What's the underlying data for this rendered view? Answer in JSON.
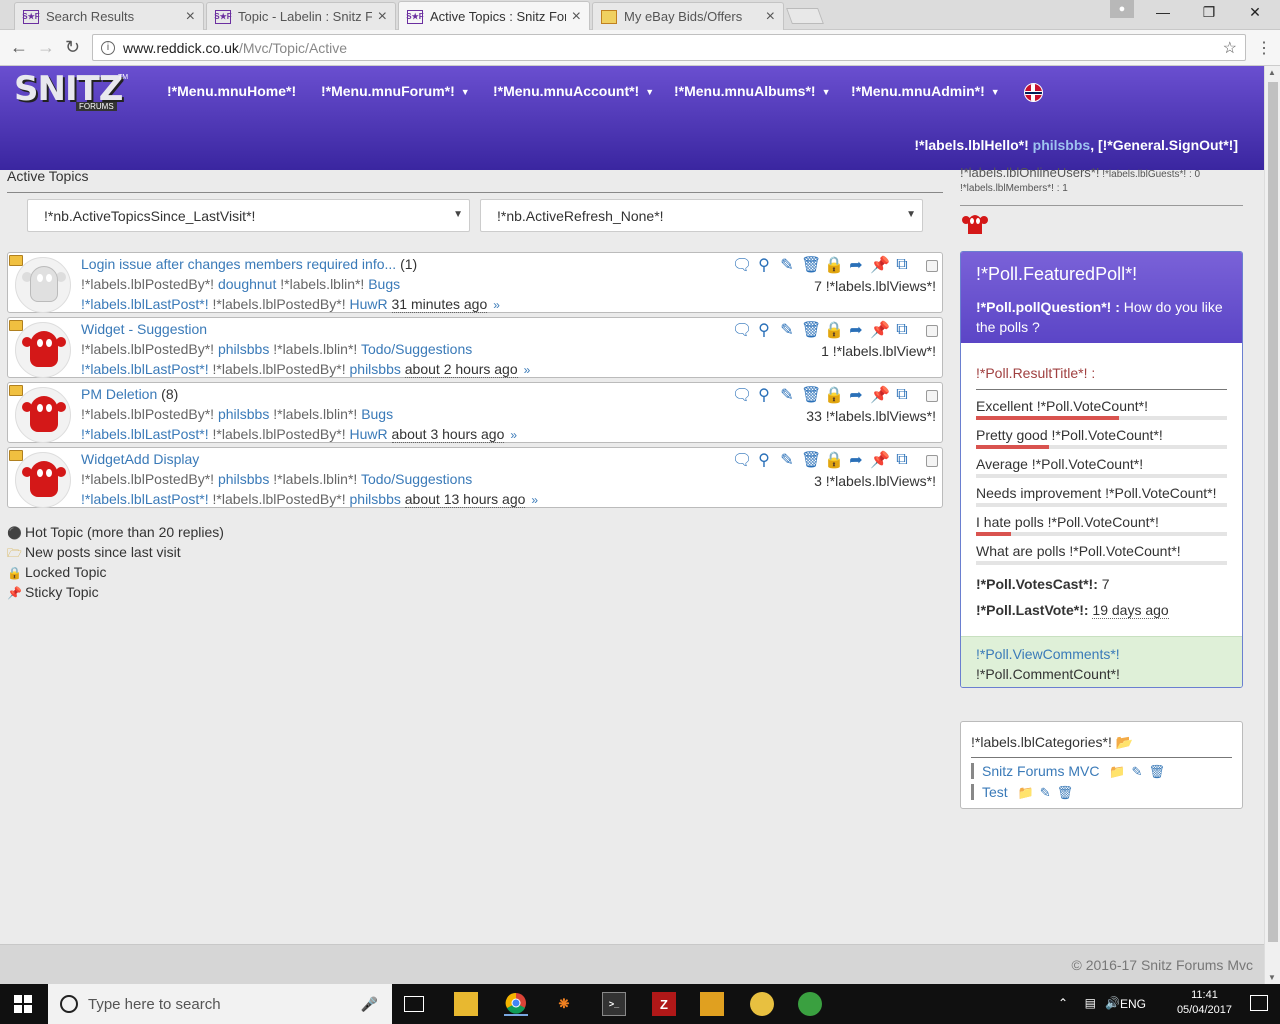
{
  "browser": {
    "tabs": [
      {
        "label": "Search Results",
        "favicon": "S★F"
      },
      {
        "label": "Topic - Labelin : Snitz For",
        "favicon": "S★F"
      },
      {
        "label": "Active Topics : Snitz Foru",
        "favicon": "S★F"
      },
      {
        "label": "My eBay Bids/Offers",
        "favicon": ""
      }
    ],
    "url_host": "www.reddick.co.uk",
    "url_path": "/Mvc/Topic/Active"
  },
  "header": {
    "logo_text": "SNITZ",
    "logo_sub": "FORUMS",
    "logo_tm": "TM",
    "menu": [
      {
        "label": "!*Menu.mnuHome*!",
        "caret": false
      },
      {
        "label": "!*Menu.mnuForum*!",
        "caret": true
      },
      {
        "label": "!*Menu.mnuAccount*!",
        "caret": true
      },
      {
        "label": "!*Menu.mnuAlbums*!",
        "caret": true
      },
      {
        "label": "!*Menu.mnuAdmin*!",
        "caret": true
      }
    ],
    "hello_prefix": "!*labels.lblHello*!",
    "username": "philsbbs",
    "signout": "[!*General.SignOut*!]"
  },
  "main": {
    "title": "Active Topics",
    "since_select": "!*nb.ActiveTopicsSince_LastVisit*!",
    "refresh_select": "!*nb.ActiveRefresh_None*!",
    "topics": [
      {
        "title": "Login issue after changes members required info...",
        "replies": "(1)",
        "posted_by_label": "!*labels.lblPostedBy*!",
        "author": "doughnut",
        "in_label": "!*labels.lblin*!",
        "forum": "Bugs",
        "last_post_label": "!*labels.lblLastPost*!",
        "last_by_label": "!*labels.lblPostedBy*!",
        "last_author": "HuwR",
        "ago": "31 minutes ago",
        "views": "7 !*labels.lblViews*!",
        "avatar": "grey"
      },
      {
        "title": "Widget - Suggestion",
        "replies": "",
        "posted_by_label": "!*labels.lblPostedBy*!",
        "author": "philsbbs",
        "in_label": "!*labels.lblin*!",
        "forum": "Todo/Suggestions",
        "last_post_label": "!*labels.lblLastPost*!",
        "last_by_label": "!*labels.lblPostedBy*!",
        "last_author": "philsbbs",
        "ago": "about 2 hours ago",
        "views": "1 !*labels.lblView*!",
        "avatar": "red"
      },
      {
        "title": "PM Deletion",
        "replies": "(8)",
        "posted_by_label": "!*labels.lblPostedBy*!",
        "author": "philsbbs",
        "in_label": "!*labels.lblin*!",
        "forum": "Bugs",
        "last_post_label": "!*labels.lblLastPost*!",
        "last_by_label": "!*labels.lblPostedBy*!",
        "last_author": "HuwR",
        "ago": "about 3 hours ago",
        "views": "33 !*labels.lblViews*!",
        "avatar": "red"
      },
      {
        "title": "WidgetAdd Display",
        "replies": "",
        "posted_by_label": "!*labels.lblPostedBy*!",
        "author": "philsbbs",
        "in_label": "!*labels.lblin*!",
        "forum": "Todo/Suggestions",
        "last_post_label": "!*labels.lblLastPost*!",
        "last_by_label": "!*labels.lblPostedBy*!",
        "last_author": "philsbbs",
        "ago": "about 13 hours ago",
        "views": "3 !*labels.lblViews*!",
        "avatar": "red"
      }
    ],
    "legend": [
      {
        "icon": "hot-topic-icon",
        "label": "Hot Topic (more than 20 replies)"
      },
      {
        "icon": "new-posts-icon",
        "label": "New posts since last visit"
      },
      {
        "icon": "lock-icon",
        "label": "Locked Topic"
      },
      {
        "icon": "pin-icon",
        "label": "Sticky Topic"
      }
    ]
  },
  "sidebar": {
    "online_users": "!*labels.lblOnlineUsers*!",
    "guests": "!*labels.lblGuests*! : 0",
    "members": "!*labels.lblMembers*! : 1",
    "poll": {
      "title": "!*Poll.FeaturedPoll*!",
      "question_label": "!*Poll.pollQuestion*! :",
      "question": "How do you like the polls ?",
      "result_title": "!*Poll.ResultTitle*! :",
      "options": [
        {
          "label": "Excellent !*Poll.VoteCount*!",
          "fraction": 0.57
        },
        {
          "label": "Pretty good !*Poll.VoteCount*!",
          "fraction": 0.29
        },
        {
          "label": "Average !*Poll.VoteCount*!",
          "fraction": 0
        },
        {
          "label": "Needs improvement !*Poll.VoteCount*!",
          "fraction": 0
        },
        {
          "label": "I hate polls !*Poll.VoteCount*!",
          "fraction": 0.14
        },
        {
          "label": "What are polls !*Poll.VoteCount*!",
          "fraction": 0
        }
      ],
      "votes_cast_label": "!*Poll.VotesCast*!:",
      "votes_cast": "7",
      "last_vote_label": "!*Poll.LastVote*!:",
      "last_vote": "19 days ago",
      "view_comments": "!*Poll.ViewComments*!",
      "comment_count": "!*Poll.CommentCount*!"
    },
    "categories": {
      "header": "!*labels.lblCategories*!",
      "items": [
        "Snitz Forums MVC",
        "Test"
      ]
    }
  },
  "footer": {
    "copyright": "© 2016-17 Snitz Forums Mvc"
  },
  "taskbar": {
    "search_placeholder": "Type here to search",
    "lang": "ENG",
    "time": "11:41",
    "date": "05/04/2017"
  }
}
